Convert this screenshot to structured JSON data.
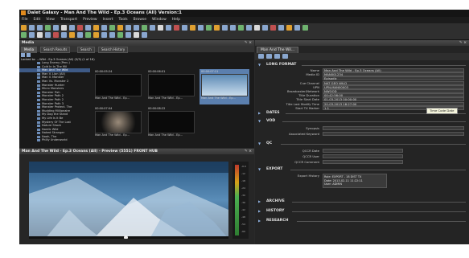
{
  "app": {
    "title": "Dalet Galaxy - Man And The Wild - Ep.3 Oceans (All) Version:1",
    "menu": [
      "File",
      "Edit",
      "View",
      "Transport",
      "Preview",
      "Insert",
      "Tools",
      "Browse",
      "Window",
      "Help"
    ]
  },
  "media_panel": {
    "title": "Media",
    "tabs": [
      "Media",
      "Search Results",
      "Search",
      "Search History"
    ],
    "path": "Locked to: ...Wild - Ep.3 Oceans (All) (3/3) (1 of 16)",
    "tree": [
      "Long Enemy (Perc.)",
      "Cold In In The Mil",
      "Man And The Wild",
      "Man V. Lion (All)",
      "Man V. Monster",
      "Man Vs. Monster 2",
      "Monster Hunter",
      "Micro Monsters",
      "Monster Fish",
      "Monster Path 2",
      "Monster Path 2",
      "Monster Path 3",
      "Monster Protect. The",
      "Mudding Millionaire",
      "My Dog the Stand",
      "My Life Is It Be",
      "Mystery Of The Lost",
      "Nature Shock",
      "Nordic Wild",
      "Naked Stranger",
      "Noah, The",
      "Philly Underworld"
    ],
    "thumbs": [
      {
        "tc": "00:00:05:24",
        "caption": "Man And The Wild - Ep..."
      },
      {
        "tc": "00:00:06:01",
        "caption": "Man And The Wild - Ep..."
      },
      {
        "tc": "00:00:07:11",
        "caption": "Man And The Wild - Ep..."
      },
      {
        "tc": "00:00:07:04",
        "caption": "Man And The Wild - Ep..."
      },
      {
        "tc": "00:00:08:22",
        "caption": "Man And The Wild - Ep..."
      }
    ]
  },
  "preview": {
    "title": "Man And The Wild - Ep.3 Oceans (All) - Preview (5551) FRONT HUB",
    "meter_labels": [
      "-6.0",
      "-12",
      "-18",
      "-24",
      "-30",
      "-36",
      "-42",
      "-48",
      "-54",
      "-60"
    ]
  },
  "metadata": {
    "tab": "Man And The Wil...",
    "sections": {
      "long_format": "LONG FORMAT",
      "dates": "DATES",
      "vod": "VOD",
      "qc": "QC",
      "export": "EXPORT",
      "archive": "ARCHIVE",
      "history": "HISTORY",
      "research": "RESEARCH"
    },
    "fields": [
      {
        "k": "Name",
        "v": "Man And The Wild - Ep.3 Oceans (All)"
      },
      {
        "k": "Media ID",
        "v": "MAN001234"
      },
      {
        "k": "",
        "v": "Episodic"
      },
      {
        "k": "Cue Channel",
        "v": "NAT GEO WILD"
      },
      {
        "k": "UPN",
        "v": "UPN-MAN00003"
      },
      {
        "k": "Broadcaster/Network",
        "v": "NWOOD"
      },
      {
        "k": "Title Duration",
        "v": "00:42:56:00"
      },
      {
        "k": "Title Start Date",
        "v": "01-03-2013   00:00:00"
      },
      {
        "k": "Title Last Modify Time",
        "v": "20-03-2013   18:27:00"
      },
      {
        "k": "Start TX Marker",
        "v": "1.1"
      }
    ],
    "vod_fields": [
      {
        "k": "Synopsis",
        "v": ""
      },
      {
        "k": "Associated Keyword",
        "v": ""
      }
    ],
    "qc_fields": [
      {
        "k": "QCCR Date",
        "v": ""
      },
      {
        "k": "QCCR User",
        "v": ""
      },
      {
        "k": "QCCR Comment",
        "v": ""
      }
    ],
    "export_history": {
      "k": "Export History",
      "v": "Role: EXPORT - 18 DIST TX\nDate: 2013-02-11 11:22:11\nUser: ADMIN"
    },
    "tooltip": "Time Code Date"
  }
}
